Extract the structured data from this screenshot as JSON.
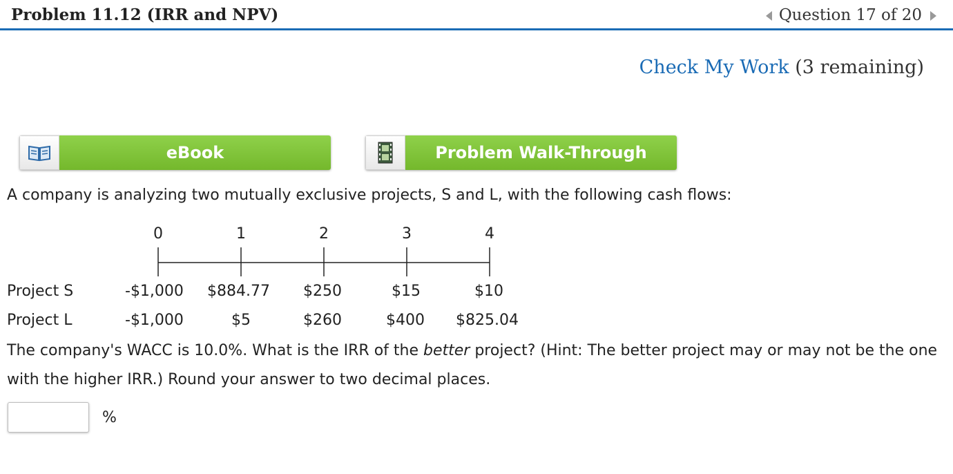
{
  "header": {
    "title": "Problem 11.12 (IRR and NPV)",
    "question_nav": "Question 17 of 20"
  },
  "check": {
    "link": "Check My Work",
    "remaining": "(3 remaining)"
  },
  "resources": {
    "ebook": "eBook",
    "walkthrough": "Problem Walk-Through"
  },
  "problem": {
    "intro": "A company is analyzing two mutually exclusive projects, S and L, with the following cash flows:",
    "periods": [
      "0",
      "1",
      "2",
      "3",
      "4"
    ],
    "projects": [
      {
        "name": "Project S",
        "cash_flows": [
          "-$1,000",
          "$884.77",
          "$250",
          "$15",
          "$10"
        ]
      },
      {
        "name": "Project L",
        "cash_flows": [
          "-$1,000",
          "$5",
          "$260",
          "$400",
          "$825.04"
        ]
      }
    ],
    "question_part1": "The company's WACC is 10.0%. What is the IRR of the ",
    "question_emph": "better",
    "question_part2": " project? (Hint: The better project may or may not be the one with the higher IRR.) Round your answer to two decimal places."
  },
  "answer": {
    "value": "",
    "unit": "%"
  }
}
